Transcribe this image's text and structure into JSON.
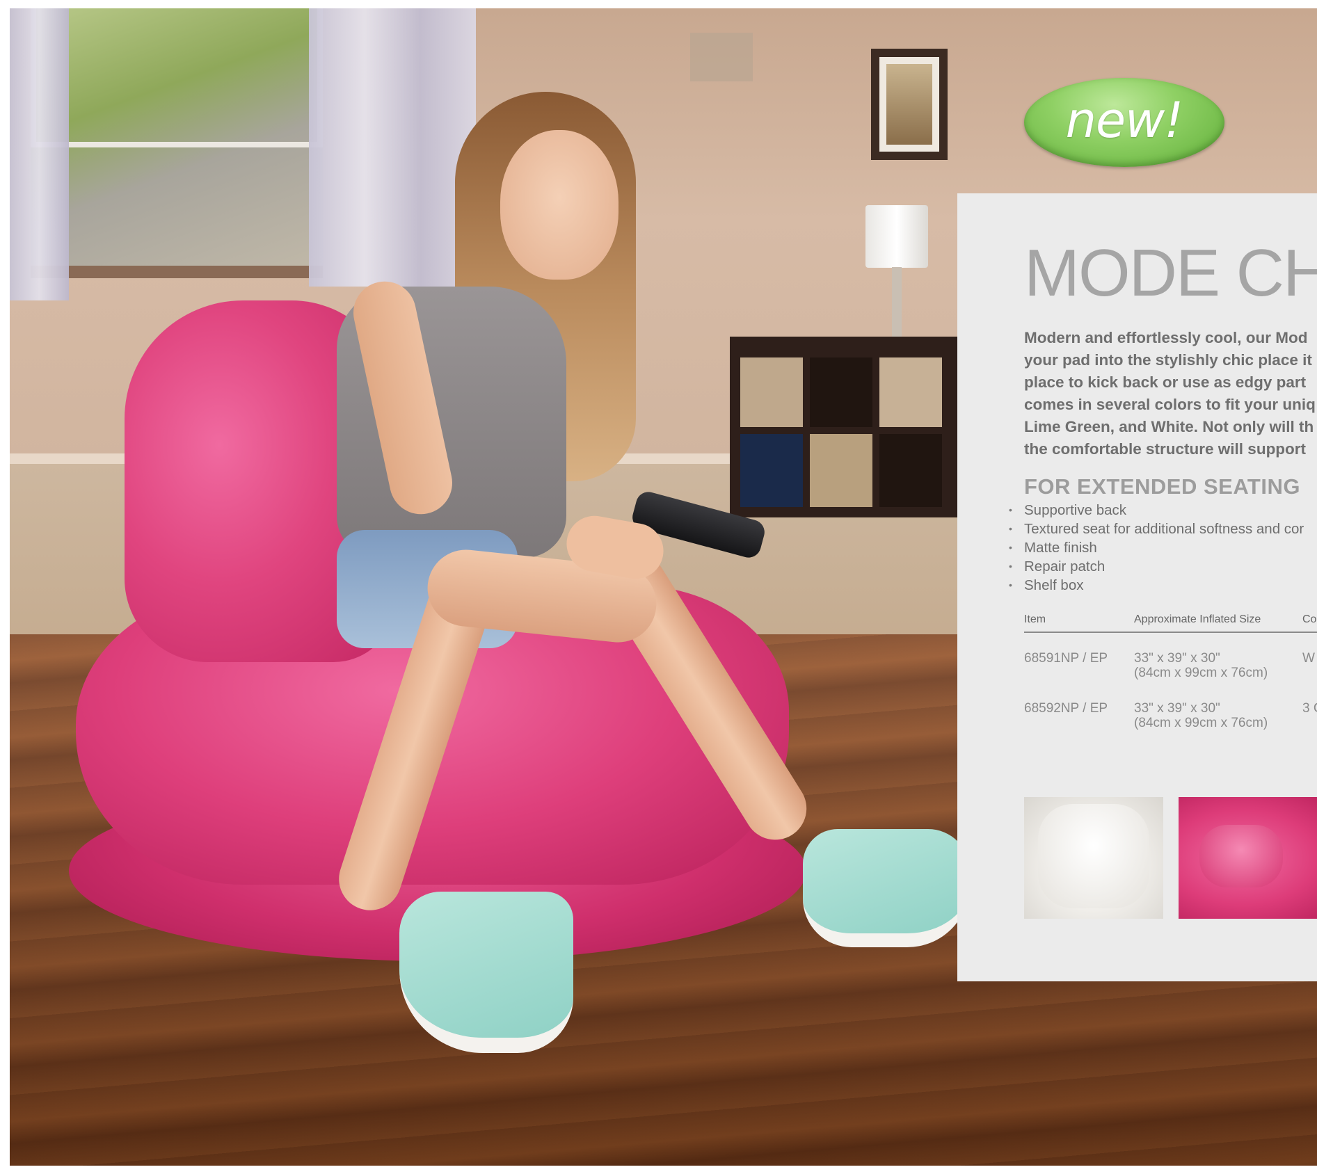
{
  "badge": {
    "text": "new!"
  },
  "panel": {
    "title": "MODE CH",
    "description_lines": [
      "Modern and effortlessly cool, our Mod",
      "your pad into the stylishly chic place it",
      "place to kick back or use as edgy part",
      "comes in several colors to fit your uniq",
      "Lime Green, and White. Not only will th",
      "the comfortable structure will support"
    ],
    "features_heading": "FOR EXTENDED SEATING",
    "features": [
      "Supportive back",
      "Textured seat for additional softness and cor",
      "Matte finish",
      "Repair patch",
      "Shelf box"
    ],
    "table": {
      "headers": [
        "Item",
        "Approximate Inflated Size",
        "Co"
      ],
      "rows": [
        {
          "item": "68591NP / EP",
          "size_imperial": "33\" x 39\" x 30\"",
          "size_metric": "(84cm x 99cm x 76cm)",
          "color": "W"
        },
        {
          "item": "68592NP / EP",
          "size_imperial": "33\" x 39\" x 30\"",
          "size_metric": "(84cm x 99cm x 76cm)",
          "color": "3 C"
        }
      ]
    }
  },
  "colors": {
    "panel_bg": "#ebebeb",
    "title_gray": "#a5a5a5",
    "chair_pink": "#de3f7b",
    "badge_green": "#8fd064"
  }
}
